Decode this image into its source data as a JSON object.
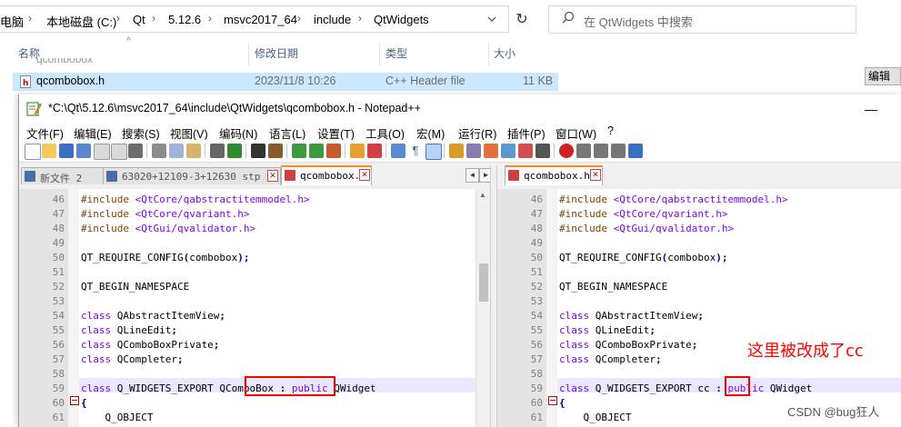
{
  "explorer": {
    "breadcrumb": [
      "电脑",
      "本地磁盘 (C:)",
      "Qt",
      "5.12.6",
      "msvc2017_64",
      "include",
      "QtWidgets"
    ],
    "search_placeholder": "在 QtWidgets 中搜索",
    "columns": {
      "name": "名称",
      "date": "修改日期",
      "type": "类型",
      "size": "大小"
    },
    "file": {
      "name": "qcombobox.h",
      "date": "2023/11/8 10:26",
      "type": "C++ Header file",
      "size": "11 KB"
    },
    "partial_row": "qcombobox",
    "edit_button": "编辑"
  },
  "npp": {
    "title": "*C:\\Qt\\5.12.6\\msvc2017_64\\include\\QtWidgets\\qcombobox.h - Notepad++",
    "minimize": "—",
    "menu": [
      "文件(F)",
      "编辑(E)",
      "搜索(S)",
      "视图(V)",
      "编码(N)",
      "语言(L)",
      "设置(T)",
      "工具(O)",
      "宏(M)",
      "运行(R)",
      "插件(P)",
      "窗口(W)",
      "?"
    ],
    "left_tabs": [
      {
        "label": "新文件 2",
        "color": "#4a6fa5"
      },
      {
        "label": "63020+12109-3+12630 stp",
        "color": "#4a6fa5"
      },
      {
        "label": "qcombobox.h",
        "color": "#d04040"
      }
    ],
    "right_tabs": [
      {
        "label": "qcombobox.h",
        "color": "#d04040"
      }
    ],
    "tab_close": "✕",
    "nav_left": "◄",
    "nav_right": "►",
    "line_numbers": [
      "46",
      "47",
      "48",
      "49",
      "50",
      "51",
      "52",
      "53",
      "54",
      "55",
      "56",
      "57",
      "58",
      "59",
      "60",
      "61"
    ],
    "left_lines": [
      [
        {
          "t": "#include ",
          "c": "pp"
        },
        {
          "t": "<QtCore/qabstractitemmodel.h>",
          "c": "inc"
        }
      ],
      [
        {
          "t": "#include ",
          "c": "pp"
        },
        {
          "t": "<QtCore/qvariant.h>",
          "c": "inc"
        }
      ],
      [
        {
          "t": "#include ",
          "c": "pp"
        },
        {
          "t": "<QtGui/qvalidator.h>",
          "c": "inc"
        }
      ],
      [],
      [
        {
          "t": "QT_REQUIRE_CONFIG",
          "c": "plain"
        },
        {
          "t": "(",
          "c": "op"
        },
        {
          "t": "combobox",
          "c": "plain"
        },
        {
          "t": ");",
          "c": "op"
        }
      ],
      [],
      [
        {
          "t": "QT_BEGIN_NAMESPACE",
          "c": "plain"
        }
      ],
      [],
      [
        {
          "t": "class",
          "c": "kw"
        },
        {
          "t": " QAbstractItemView",
          "c": "plain"
        },
        {
          "t": ";",
          "c": "op"
        }
      ],
      [
        {
          "t": "class",
          "c": "kw"
        },
        {
          "t": " QLineEdit",
          "c": "plain"
        },
        {
          "t": ";",
          "c": "op"
        }
      ],
      [
        {
          "t": "class",
          "c": "kw"
        },
        {
          "t": " QComboBoxPrivate",
          "c": "plain"
        },
        {
          "t": ";",
          "c": "op"
        }
      ],
      [
        {
          "t": "class",
          "c": "kw"
        },
        {
          "t": " QCompleter",
          "c": "plain"
        },
        {
          "t": ";",
          "c": "op"
        }
      ],
      [],
      [
        {
          "t": "class",
          "c": "kw"
        },
        {
          "t": " Q_WIDGETS_EXPORT ",
          "c": "plain"
        },
        {
          "t": "QComboBox",
          "c": "plain"
        },
        {
          "t": " : ",
          "c": "op"
        },
        {
          "t": "public",
          "c": "kw"
        },
        {
          "t": " QWidget",
          "c": "plain"
        }
      ],
      [
        {
          "t": "{",
          "c": "op"
        }
      ],
      [
        {
          "t": "    Q_OBJECT",
          "c": "plain"
        }
      ]
    ],
    "right_lines": [
      [
        {
          "t": "#include ",
          "c": "pp"
        },
        {
          "t": "<QtCore/qabstractitemmodel.h>",
          "c": "inc"
        }
      ],
      [
        {
          "t": "#include ",
          "c": "pp"
        },
        {
          "t": "<QtCore/qvariant.h>",
          "c": "inc"
        }
      ],
      [
        {
          "t": "#include ",
          "c": "pp"
        },
        {
          "t": "<QtGui/qvalidator.h>",
          "c": "inc"
        }
      ],
      [],
      [
        {
          "t": "QT_REQUIRE_CONFIG",
          "c": "plain"
        },
        {
          "t": "(",
          "c": "op"
        },
        {
          "t": "combobox",
          "c": "plain"
        },
        {
          "t": ");",
          "c": "op"
        }
      ],
      [],
      [
        {
          "t": "QT_BEGIN_NAMESPACE",
          "c": "plain"
        }
      ],
      [],
      [
        {
          "t": "class",
          "c": "kw"
        },
        {
          "t": " QAbstractItemView",
          "c": "plain"
        },
        {
          "t": ";",
          "c": "op"
        }
      ],
      [
        {
          "t": "class",
          "c": "kw"
        },
        {
          "t": " QLineEdit",
          "c": "plain"
        },
        {
          "t": ";",
          "c": "op"
        }
      ],
      [
        {
          "t": "class",
          "c": "kw"
        },
        {
          "t": " QComboBoxPrivate",
          "c": "plain"
        },
        {
          "t": ";",
          "c": "op"
        }
      ],
      [
        {
          "t": "class",
          "c": "kw"
        },
        {
          "t": " QCompleter",
          "c": "plain"
        },
        {
          "t": ";",
          "c": "op"
        }
      ],
      [],
      [
        {
          "t": "class",
          "c": "kw"
        },
        {
          "t": " Q_WIDGETS_EXPORT ",
          "c": "plain"
        },
        {
          "t": "cc",
          "c": "plain"
        },
        {
          "t": " : ",
          "c": "op"
        },
        {
          "t": "public",
          "c": "kw"
        },
        {
          "t": " QWidget",
          "c": "plain"
        }
      ],
      [
        {
          "t": "{",
          "c": "op"
        }
      ],
      [
        {
          "t": "    Q_OBJECT",
          "c": "plain"
        }
      ]
    ]
  },
  "annotation": "这里被改成了cc",
  "watermark": "CSDN @bug狂人",
  "colors": {
    "highlight_box": "#ff0000",
    "selected_row": "#cce8ff",
    "current_line": "#e8e8ff",
    "active_tab_top": "#fa8c28"
  }
}
